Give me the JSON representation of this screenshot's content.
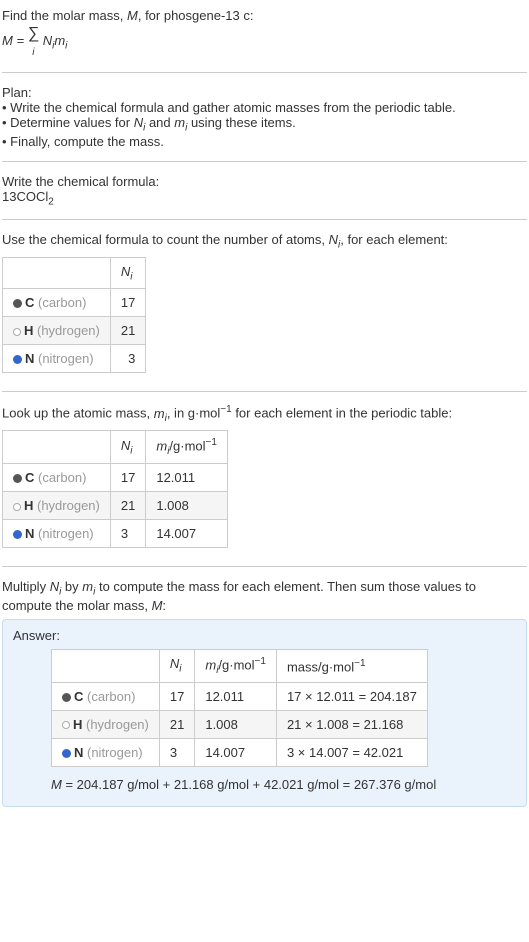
{
  "intro": {
    "line1_prefix": "Find the molar mass, ",
    "line1_M": "M",
    "line1_suffix": ", for phosgene-13 c:",
    "eq_lhs": "M",
    "eq_eq": " = ",
    "eq_sum": "∑",
    "eq_sub": "i",
    "eq_rhs_N": "N",
    "eq_rhs_m": "m"
  },
  "plan": {
    "title": "Plan:",
    "b1_a": "• Write the chemical formula and gather atomic masses from the periodic table.",
    "b2_a": "• Determine values for ",
    "b2_N": "N",
    "b2_i1": "i",
    "b2_b": " and ",
    "b2_m": "m",
    "b2_i2": "i",
    "b2_c": " using these items.",
    "b3": "• Finally, compute the mass."
  },
  "chem": {
    "title": "Write the chemical formula:",
    "formula_a": "13COCl",
    "formula_sub": "2"
  },
  "count": {
    "intro_a": "Use the chemical formula to count the number of atoms, ",
    "intro_N": "N",
    "intro_i": "i",
    "intro_b": ", for each element:",
    "header_N": "N",
    "header_i": "i",
    "rows": [
      {
        "sym": "C",
        "name": " (carbon)",
        "n": "17"
      },
      {
        "sym": "H",
        "name": " (hydrogen)",
        "n": "21"
      },
      {
        "sym": "N",
        "name": " (nitrogen)",
        "n": "3"
      }
    ]
  },
  "atomic": {
    "intro_a": "Look up the atomic mass, ",
    "intro_m": "m",
    "intro_i": "i",
    "intro_b": ", in g·mol",
    "intro_exp": "−1",
    "intro_c": " for each element in the periodic table:",
    "h_N": "N",
    "h_Ni": "i",
    "h_m": "m",
    "h_mi": "i",
    "h_unit_a": "/g·mol",
    "h_unit_exp": "−1",
    "rows": [
      {
        "sym": "C",
        "name": " (carbon)",
        "n": "17",
        "m": "12.011"
      },
      {
        "sym": "H",
        "name": " (hydrogen)",
        "n": "21",
        "m": "1.008"
      },
      {
        "sym": "N",
        "name": " (nitrogen)",
        "n": "3",
        "m": "14.007"
      }
    ]
  },
  "multiply": {
    "a": "Multiply ",
    "N": "N",
    "Ni": "i",
    "b": " by ",
    "m": "m",
    "mi": "i",
    "c": " to compute the mass for each element. Then sum those values to compute the molar mass, ",
    "M": "M",
    "d": ":"
  },
  "answer": {
    "label": "Answer:",
    "h_N": "N",
    "h_Ni": "i",
    "h_m": "m",
    "h_mi": "i",
    "h_m_unit_a": "/g·mol",
    "h_m_unit_exp": "−1",
    "h_mass_a": "mass/g·mol",
    "h_mass_exp": "−1",
    "rows": [
      {
        "sym": "C",
        "name": " (carbon)",
        "n": "17",
        "m": "12.011",
        "calc": "17 × 12.011 = 204.187"
      },
      {
        "sym": "H",
        "name": " (hydrogen)",
        "n": "21",
        "m": "1.008",
        "calc": "21 × 1.008 = 21.168"
      },
      {
        "sym": "N",
        "name": " (nitrogen)",
        "n": "3",
        "m": "14.007",
        "calc": "3 × 14.007 = 42.021"
      }
    ],
    "final_M": "M",
    "final_eq": " = 204.187 g/mol + 21.168 g/mol + 42.021 g/mol = 267.376 g/mol"
  }
}
